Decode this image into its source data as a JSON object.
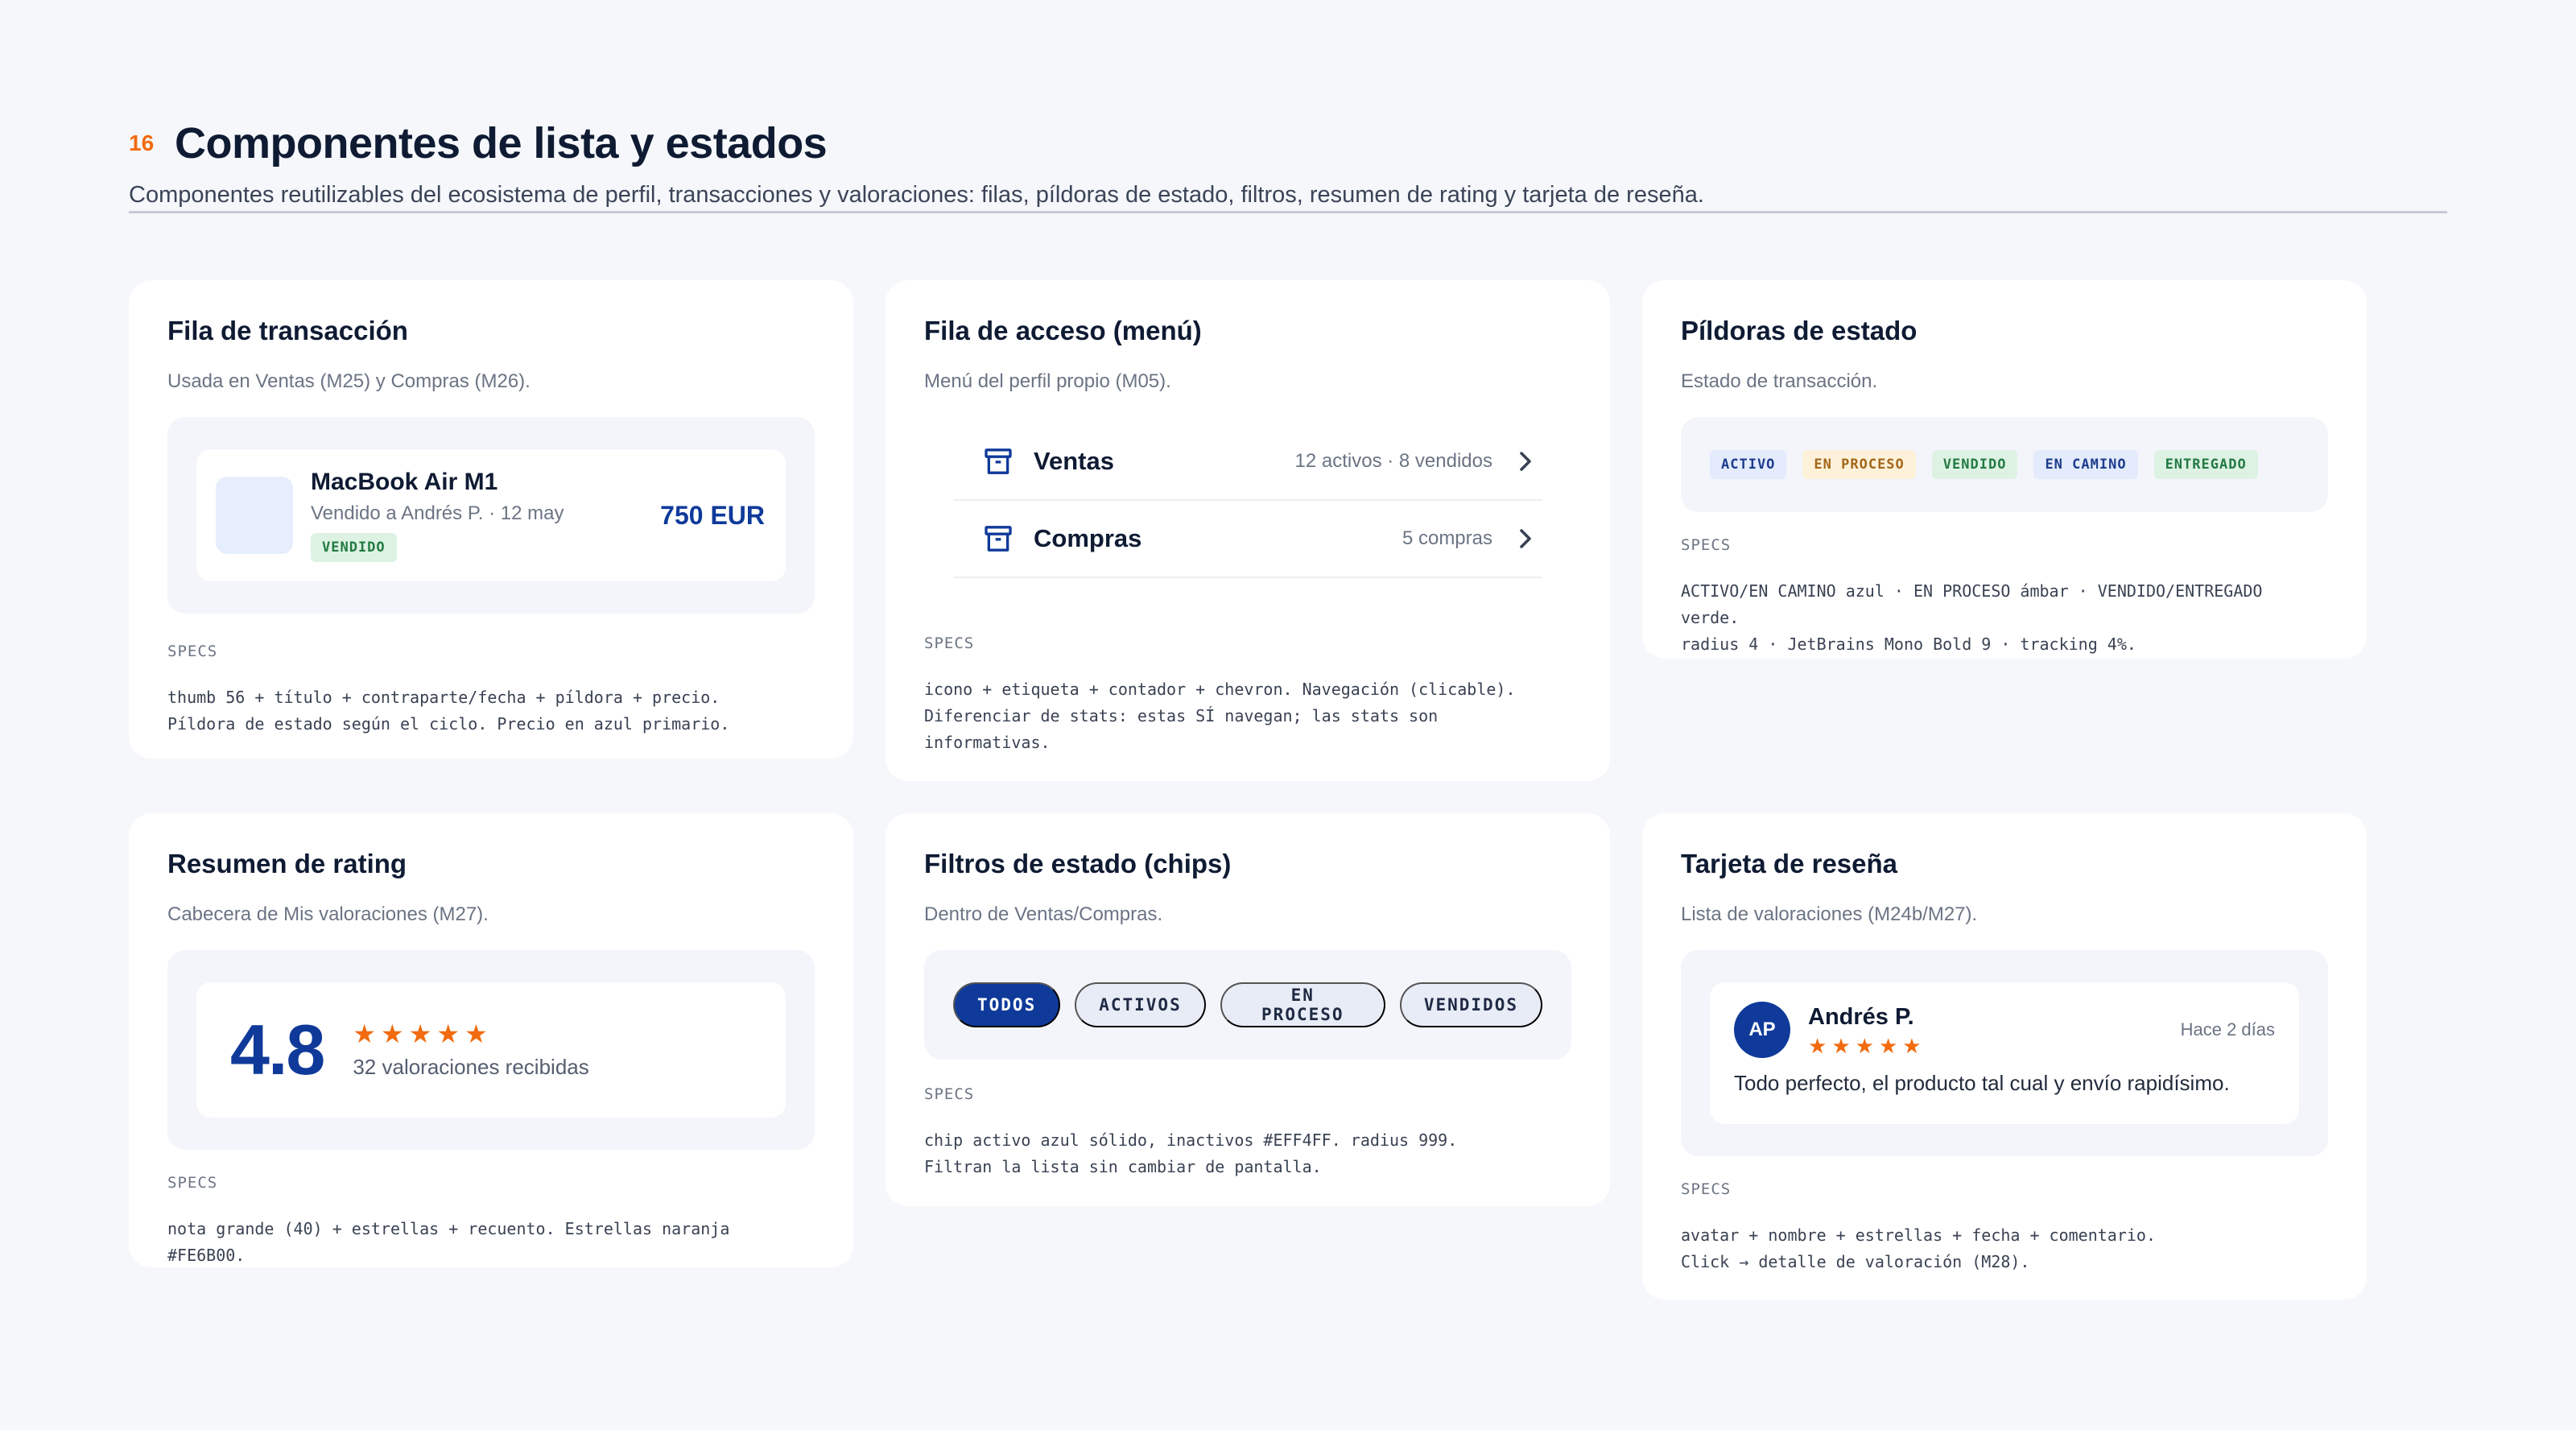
{
  "header": {
    "number": "16",
    "title": "Componentes de lista y estados",
    "subtitle": "Componentes reutilizables del ecosistema de perfil, transacciones y valoraciones: filas, píldoras de estado, filtros, resumen de rating y tarjeta de reseña."
  },
  "colors": {
    "primary": "#0F3A9A",
    "accent_orange": "#F26B0F",
    "chip_inactive": "#EFF4FF"
  },
  "transaction_row": {
    "title": "Fila de transacción",
    "description": "Usada en Ventas (M25) y Compras (M26).",
    "item_title": "MacBook Air M1",
    "item_meta": "Vendido a Andrés P. · 12 may",
    "item_status": "VENDIDO",
    "item_price": "750 EUR",
    "specs_label": "SPECS",
    "specs": "thumb 56 + título + contraparte/fecha + píldora + precio.\nPíldora de estado según el ciclo. Precio en azul primario."
  },
  "access_row": {
    "title": "Fila de acceso (menú)",
    "description": "Menú del perfil propio (M05).",
    "items": [
      {
        "icon": "archive-box-icon",
        "label": "Ventas",
        "count": "12 activos · 8 vendidos"
      },
      {
        "icon": "archive-box-icon",
        "label": "Compras",
        "count": "5 compras"
      }
    ],
    "specs_label": "SPECS",
    "specs": "icono + etiqueta + contador + chevron. Navegación (clicable).\nDiferenciar de stats: estas SÍ navegan; las stats son informativas."
  },
  "status_pills": {
    "title": "Píldoras de estado",
    "description": "Estado de transacción.",
    "pills": [
      {
        "label": "ACTIVO",
        "bg": "#E3EBFC",
        "fg": "#1E3C8C"
      },
      {
        "label": "EN PROCESO",
        "bg": "#FDF1D9",
        "fg": "#A4661A"
      },
      {
        "label": "VENDIDO",
        "bg": "#DDF2E3",
        "fg": "#227A43"
      },
      {
        "label": "EN CAMINO",
        "bg": "#E3EBFC",
        "fg": "#1E3C8C"
      },
      {
        "label": "ENTREGADO",
        "bg": "#DDF2E3",
        "fg": "#227A43"
      }
    ],
    "specs_label": "SPECS",
    "specs": "ACTIVO/EN CAMINO azul · EN PROCESO ámbar · VENDIDO/ENTREGADO verde.\nradius 4 · JetBrains Mono Bold 9 · tracking 4%."
  },
  "rating_summary": {
    "title": "Resumen de rating",
    "description": "Cabecera de Mis valoraciones (M27).",
    "score": "4.8",
    "stars": 5,
    "count_label": "32 valoraciones recibidas",
    "specs_label": "SPECS",
    "specs": "nota grande (40) + estrellas + recuento. Estrellas naranja #FE6B00."
  },
  "status_filters": {
    "title": "Filtros de estado (chips)",
    "description": "Dentro de Ventas/Compras.",
    "chips": [
      {
        "label": "TODOS",
        "active": true
      },
      {
        "label": "ACTIVOS",
        "active": false
      },
      {
        "label": "EN PROCESO",
        "active": false
      },
      {
        "label": "VENDIDOS",
        "active": false
      }
    ],
    "specs_label": "SPECS",
    "specs": "chip activo azul sólido, inactivos #EFF4FF. radius 999.\nFiltran la lista sin cambiar de pantalla."
  },
  "review_card": {
    "title": "Tarjeta de reseña",
    "description": "Lista de valoraciones (M24b/M27).",
    "avatar_initials": "AP",
    "author": "Andrés P.",
    "stars": 5,
    "date": "Hace 2 días",
    "comment": "Todo perfecto, el producto tal cual y envío rapidísimo.",
    "specs_label": "SPECS",
    "specs": "avatar + nombre + estrellas + fecha + comentario.\nClick → detalle de valoración (M28)."
  }
}
